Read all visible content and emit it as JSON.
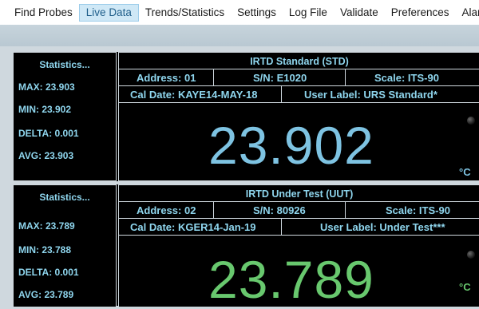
{
  "menu": {
    "items": [
      {
        "label": "Find Probes",
        "active": false
      },
      {
        "label": "Live Data",
        "active": true
      },
      {
        "label": "Trends/Statistics",
        "active": false
      },
      {
        "label": "Settings",
        "active": false
      },
      {
        "label": "Log File",
        "active": false
      },
      {
        "label": "Validate",
        "active": false
      },
      {
        "label": "Preferences",
        "active": false
      },
      {
        "label": "Alarms",
        "active": false
      }
    ]
  },
  "probes": [
    {
      "stats": {
        "title": "Statistics...",
        "max": "MAX: 23.903",
        "min": "MIN: 23.902",
        "delta": "DELTA: 0.001",
        "avg": "AVG: 23.903"
      },
      "title": "IRTD Standard (STD)",
      "address": "Address: 01",
      "serial": "S/N: E1020",
      "scale": "Scale: ITS-90",
      "cal_date": "Cal Date: KAYE14-MAY-18",
      "user_label": "User Label: URS Standard*",
      "reading": "23.902",
      "unit": "°C",
      "reading_color": "#7ec3e2"
    },
    {
      "stats": {
        "title": "Statistics...",
        "max": "MAX: 23.789",
        "min": "MIN: 23.788",
        "delta": "DELTA: 0.001",
        "avg": "AVG: 23.789"
      },
      "title": "IRTD Under Test (UUT)",
      "address": "Address: 02",
      "serial": "S/N: 80926",
      "scale": "Scale: ITS-90",
      "cal_date": "Cal Date: KGER14-Jan-19",
      "user_label": "User Label: Under Test***",
      "reading": "23.789",
      "unit": "°C",
      "reading_color": "#68c86e"
    }
  ]
}
